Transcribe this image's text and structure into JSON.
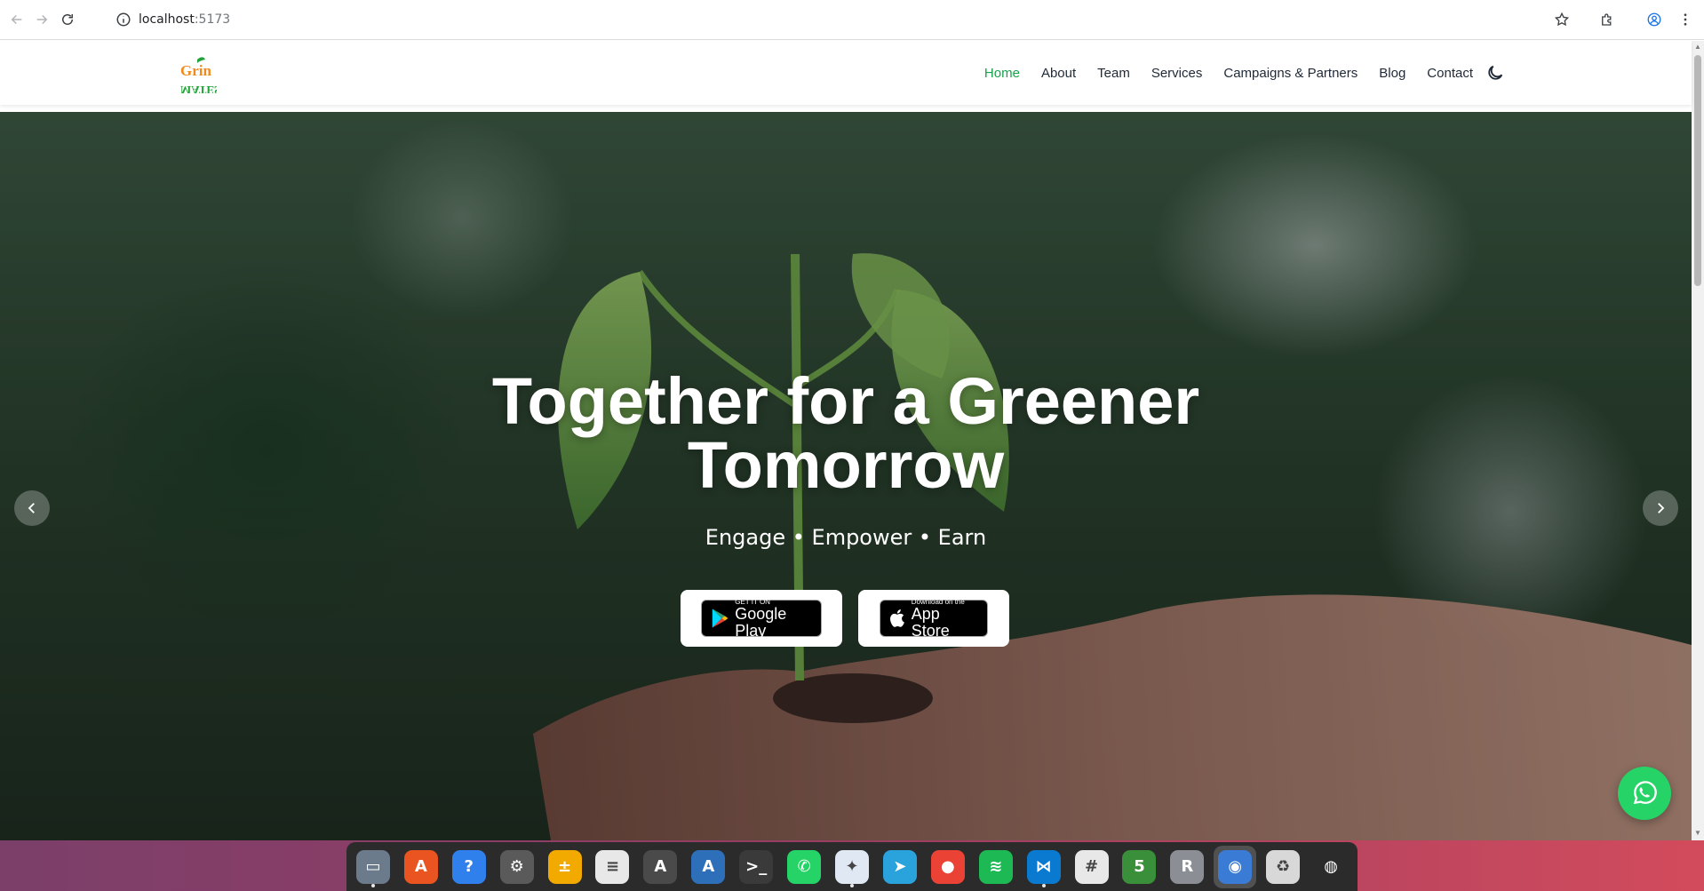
{
  "browser": {
    "url_host": "localhost",
    "url_port": ":5173",
    "back_icon": "arrow-left-icon",
    "forward_icon": "arrow-right-icon",
    "reload_icon": "reload-icon",
    "site_info_icon": "info-icon",
    "bookmark_icon": "star-icon",
    "extensions_icon": "puzzle-icon",
    "profile_icon": "profile-icon",
    "menu_icon": "kebab-menu-icon"
  },
  "site": {
    "logo": {
      "top": "Grin",
      "bottom": "MATES"
    },
    "nav": [
      {
        "label": "Home",
        "active": true
      },
      {
        "label": "About",
        "active": false
      },
      {
        "label": "Team",
        "active": false
      },
      {
        "label": "Services",
        "active": false
      },
      {
        "label": "Campaigns & Partners",
        "active": false
      },
      {
        "label": "Blog",
        "active": false
      },
      {
        "label": "Contact",
        "active": false
      }
    ],
    "theme_toggle_icon": "moon-icon",
    "accent": "#16a34a"
  },
  "hero": {
    "title": "Together for a Greener Tomorrow",
    "subtitle": "Engage • Empower • Earn",
    "google_play": {
      "small": "GET IT ON",
      "big": "Google Play"
    },
    "app_store": {
      "small": "Download on the",
      "big": "App Store"
    },
    "prev_icon": "chevron-left-icon",
    "next_icon": "chevron-right-icon"
  },
  "whatsapp": {
    "icon": "whatsapp-icon",
    "color": "#25d366"
  },
  "dock": {
    "apps": [
      {
        "name": "files",
        "color": "#6b7b8c",
        "glyph": "▭",
        "running": true,
        "active": false
      },
      {
        "name": "app-center",
        "color": "#e95420",
        "glyph": "A",
        "running": false,
        "active": false
      },
      {
        "name": "help",
        "color": "#2f80ed",
        "glyph": "?",
        "running": false,
        "active": false
      },
      {
        "name": "settings",
        "color": "#5a5a5a",
        "glyph": "⚙",
        "running": false,
        "active": false
      },
      {
        "name": "calculator",
        "color": "#f2a900",
        "glyph": "±",
        "running": false,
        "active": false
      },
      {
        "name": "document-viewer",
        "color": "#e8e8e8",
        "glyph": "≡",
        "running": false,
        "active": false
      },
      {
        "name": "software-updater",
        "color": "#4a4a4a",
        "glyph": "A",
        "running": false,
        "active": false
      },
      {
        "name": "app-installer",
        "color": "#2d6fb8",
        "glyph": "A",
        "running": false,
        "active": false
      },
      {
        "name": "terminal",
        "color": "#3a3a3a",
        "glyph": ">_",
        "running": false,
        "active": false
      },
      {
        "name": "whatsapp",
        "color": "#25d366",
        "glyph": "✆",
        "running": false,
        "active": false
      },
      {
        "name": "inkscape-tool",
        "color": "#dfe8f3",
        "glyph": "✦",
        "running": true,
        "active": false
      },
      {
        "name": "telegram",
        "color": "#2aa3dd",
        "glyph": "➤",
        "running": false,
        "active": false
      },
      {
        "name": "chrome",
        "color": "#ea4335",
        "glyph": "●",
        "running": false,
        "active": false
      },
      {
        "name": "spotify",
        "color": "#1db954",
        "glyph": "≋",
        "running": false,
        "active": false
      },
      {
        "name": "vscode",
        "color": "#0a7ad1",
        "glyph": "⋈",
        "running": true,
        "active": false
      },
      {
        "name": "slack",
        "color": "#e8e8e8",
        "glyph": "#",
        "running": false,
        "active": false
      },
      {
        "name": "metatrader",
        "color": "#3a8f3a",
        "glyph": "5",
        "running": false,
        "active": false
      },
      {
        "name": "r-lang",
        "color": "#8b8f95",
        "glyph": "R",
        "running": false,
        "active": false
      },
      {
        "name": "chromium",
        "color": "#3a7bd5",
        "glyph": "◉",
        "running": false,
        "active": true
      },
      {
        "name": "trash",
        "color": "#d8d8d8",
        "glyph": "♻",
        "running": false,
        "active": false
      },
      {
        "name": "ubuntu",
        "color": "#2b2b2b",
        "glyph": "◍",
        "running": false,
        "active": false
      }
    ]
  }
}
